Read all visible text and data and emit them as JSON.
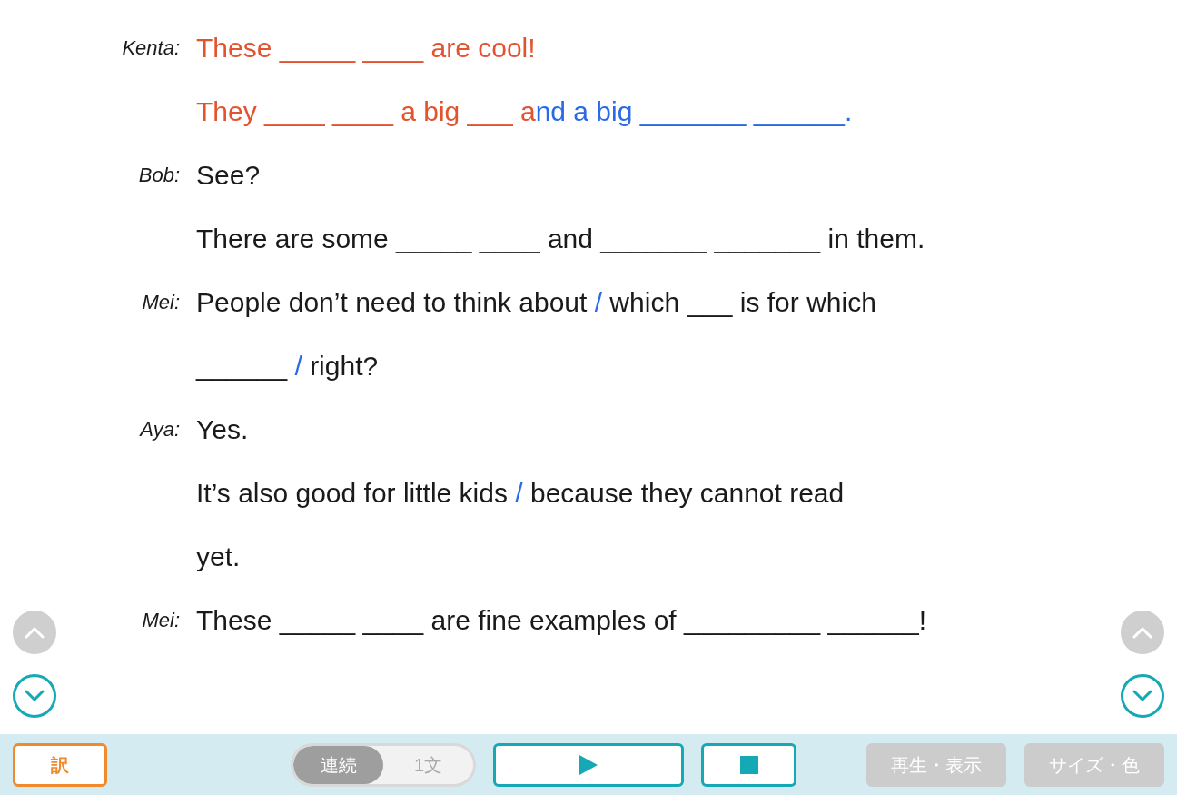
{
  "lines": [
    {
      "speaker": "Kenta:",
      "segments": [
        {
          "kind": "read",
          "text": "These _____ ____ are cool!"
        }
      ]
    },
    {
      "segments": [
        {
          "kind": "read",
          "text": "They ____ ____ a big ___ a"
        },
        {
          "kind": "reading",
          "text": "nd a big _______ ______."
        }
      ]
    },
    {
      "speaker": "Bob:",
      "segments": [
        {
          "kind": "plain",
          "text": "See?"
        }
      ]
    },
    {
      "segments": [
        {
          "kind": "plain",
          "text": "There are some _____ ____ and _______ _______ in them."
        }
      ]
    },
    {
      "speaker": "Mei:",
      "segments": [
        {
          "kind": "plain",
          "text": "People don’t need to think about "
        },
        {
          "kind": "slash",
          "text": "/"
        },
        {
          "kind": "plain",
          "text": " which ___ is for which"
        }
      ]
    },
    {
      "segments": [
        {
          "kind": "plain",
          "text": "______ "
        },
        {
          "kind": "slash",
          "text": "/"
        },
        {
          "kind": "plain",
          "text": " right?"
        }
      ]
    },
    {
      "speaker": "Aya:",
      "segments": [
        {
          "kind": "plain",
          "text": "Yes."
        }
      ]
    },
    {
      "segments": [
        {
          "kind": "plain",
          "text": "It’s also good for little kids "
        },
        {
          "kind": "slash",
          "text": "/"
        },
        {
          "kind": "plain",
          "text": " because they cannot read"
        }
      ]
    },
    {
      "segments": [
        {
          "kind": "plain",
          "text": "yet."
        }
      ]
    },
    {
      "speaker": "Mei:",
      "segments": [
        {
          "kind": "plain",
          "text": "These _____ ____ are fine examples of _________ ______!"
        }
      ]
    }
  ],
  "side_nav": {
    "left": [
      {
        "kind": "up",
        "disabled": true
      },
      {
        "kind": "down",
        "disabled": false
      }
    ],
    "right": [
      {
        "kind": "up",
        "disabled": true
      },
      {
        "kind": "down",
        "disabled": false
      }
    ]
  },
  "toolbar": {
    "translate_button": "訳",
    "mode_toggle": [
      {
        "label": "連続",
        "selected": true
      },
      {
        "label": "1文",
        "selected": false
      }
    ],
    "play_button": {
      "disabled": false
    },
    "stop_button": {
      "disabled": false
    },
    "right_buttons": [
      {
        "label": "再生・表示",
        "disabled": true
      },
      {
        "label": "サイズ・色",
        "disabled": true
      }
    ]
  }
}
